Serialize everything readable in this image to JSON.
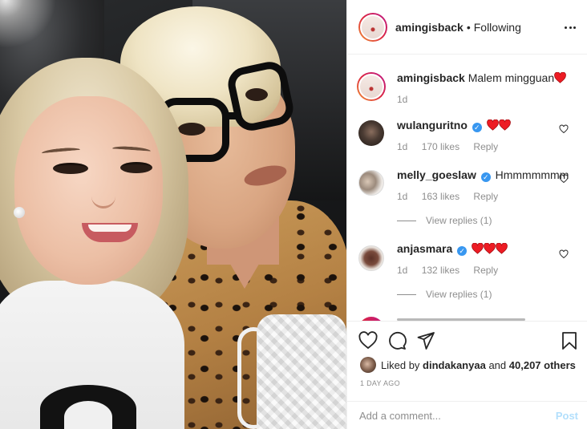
{
  "header": {
    "username": "amingisback",
    "separator": "•",
    "follow_status": "Following"
  },
  "caption": {
    "username": "amingisback",
    "text": "Malem mingguan",
    "time": "1d"
  },
  "comments": [
    {
      "username": "wulanguritno",
      "verified": true,
      "text": "",
      "hearts": 2,
      "time": "1d",
      "likes": "170 likes",
      "reply": "Reply"
    },
    {
      "username": "melly_goeslaw",
      "verified": true,
      "text": "Hmmmmmmm",
      "hearts": 0,
      "time": "1d",
      "likes": "163 likes",
      "reply": "Reply",
      "view_replies": "View replies (1)"
    },
    {
      "username": "anjasmara",
      "verified": true,
      "text": "",
      "hearts": 3,
      "time": "1d",
      "likes": "132 likes",
      "reply": "Reply",
      "view_replies": "View replies (1)"
    }
  ],
  "likes": {
    "prefix": "Liked by",
    "user": "dindakanyaa",
    "middle": "and",
    "count": "40,207 others"
  },
  "date": "1 DAY AGO",
  "add_comment": {
    "placeholder": "Add a comment...",
    "post_label": "Post"
  },
  "colors": {
    "heart_red": "#ed4956",
    "verified_blue": "#3897f0",
    "post_disabled": "#b2dffc",
    "meta_grey": "#8e8e8e"
  },
  "icons": [
    "more-options-icon",
    "heart-icon",
    "comment-icon",
    "share-icon",
    "bookmark-icon",
    "verified-badge-icon",
    "red-heart-emoji"
  ]
}
